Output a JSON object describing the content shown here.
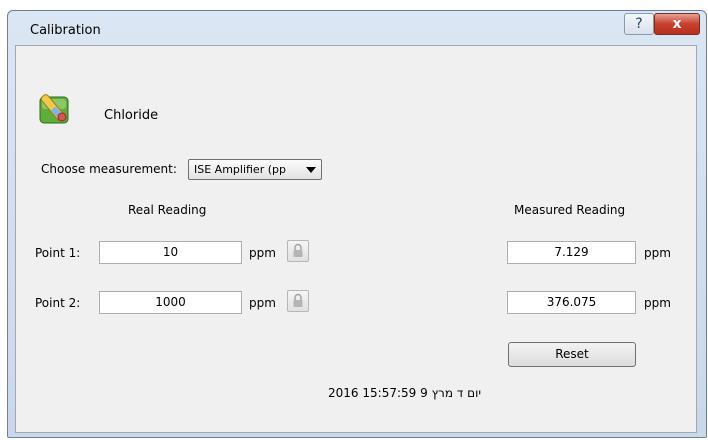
{
  "window": {
    "title": "Calibration",
    "help_label": "?",
    "close_label": "x"
  },
  "sensor": {
    "name": "Chloride",
    "icon": "chloride-sensor-icon"
  },
  "measurement": {
    "label": "Choose measurement:",
    "selected": "ISE Amplifier (pp"
  },
  "headers": {
    "real": "Real Reading",
    "measured": "Measured Reading"
  },
  "points": [
    {
      "label": "Point 1:",
      "real_value": "10",
      "real_unit": "ppm",
      "measured_value": "7.129",
      "measured_unit": "ppm"
    },
    {
      "label": "Point 2:",
      "real_value": "1000",
      "real_unit": "ppm",
      "measured_value": "376.075",
      "measured_unit": "ppm"
    }
  ],
  "reset_label": "Reset",
  "timestamp": "יום ד מרץ 9 15:57:59 2016"
}
